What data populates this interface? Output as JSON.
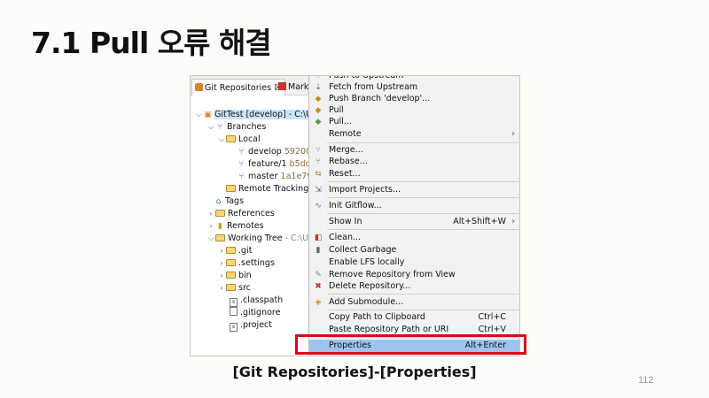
{
  "slide": {
    "title": "7.1 Pull 오류 해결",
    "caption": "[Git Repositories]-[Properties]",
    "page_number": "112"
  },
  "tabs": [
    {
      "label": "Git Repositories ☒"
    },
    {
      "label": "Mark"
    }
  ],
  "tree": {
    "repo": "GitTest [develop] - C:\\Us",
    "branches": "Branches",
    "local": "Local",
    "develop": "develop",
    "develop_hash": "592001(",
    "feature": "feature/1",
    "feature_hash": "b5dd9",
    "master": "master",
    "master_hash": "1a1e79e",
    "remote_tracking": "Remote Tracking",
    "tags": "Tags",
    "references": "References",
    "remotes": "Remotes",
    "working_tree": "Working Tree",
    "working_tree_path": "- C:\\Us",
    "git": ".git",
    "settings": ".settings",
    "bin": "bin",
    "src": "src",
    "classpath": ".classpath",
    "gitignore": ".gitignore",
    "project": ".project"
  },
  "menu": {
    "push_upstream": "Push to Upstream",
    "fetch_upstream": "Fetch from Upstream",
    "push_branch": "Push Branch 'develop'...",
    "pull": "Pull",
    "pull_dots": "Pull...",
    "remote": "Remote",
    "merge": "Merge...",
    "rebase": "Rebase...",
    "reset": "Reset...",
    "import_projects": "Import Projects...",
    "init_gitflow": "Init Gitflow...",
    "show_in": "Show In",
    "show_in_shortcut": "Alt+Shift+W",
    "clean": "Clean...",
    "collect_garbage": "Collect Garbage",
    "enable_lfs": "Enable LFS locally",
    "remove_repo": "Remove Repository from View",
    "delete_repo": "Delete Repository...",
    "add_submodule": "Add Submodule...",
    "copy_path": "Copy Path to Clipboard",
    "copy_path_shortcut": "Ctrl+C",
    "paste_repo": "Paste Repository Path or URI",
    "paste_repo_shortcut": "Ctrl+V",
    "properties": "Properties",
    "properties_shortcut": "Alt+Enter"
  },
  "colors": {
    "highlight_border": "#e3001b",
    "selected_item": "#9fc3ee"
  }
}
